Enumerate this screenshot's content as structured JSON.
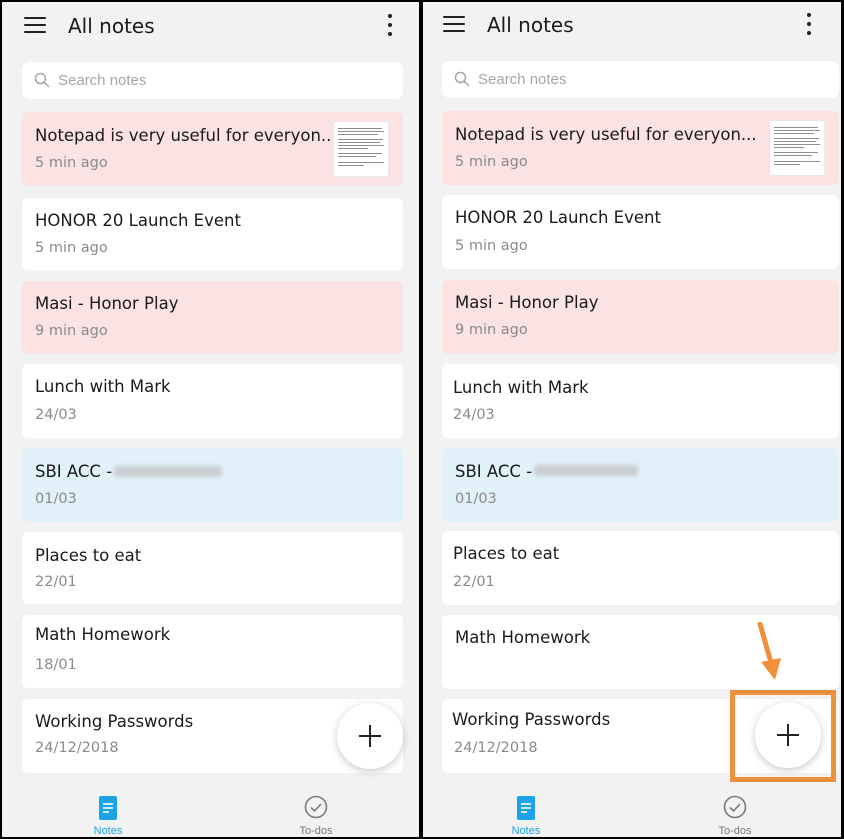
{
  "app": {
    "title": "All notes",
    "search_placeholder": "Search notes",
    "notes": [
      {
        "title": "Notepad is very useful for everyon...",
        "time": "5 min ago",
        "color": "#fbe2e3",
        "has_thumbnail": true
      },
      {
        "title": "HONOR 20 Launch Event",
        "time": "5 min ago",
        "color": "#ffffff"
      },
      {
        "title": "Masi - Honor Play",
        "time": "9 min ago",
        "color": "#fbe2e3"
      },
      {
        "title": "Lunch with Mark",
        "time": "24/03",
        "color": "#ffffff"
      },
      {
        "title": "SBI ACC -",
        "time": "01/03",
        "color": "#e1f1fa",
        "redacted": true
      },
      {
        "title": "Places to eat",
        "time": "22/01",
        "color": "#ffffff"
      },
      {
        "title": "Math Homework",
        "time": "18/01",
        "color": "#ffffff"
      },
      {
        "title": "Working Passwords",
        "time": "24/12/2018",
        "color": "#ffffff"
      }
    ],
    "bottom_nav": [
      {
        "label": "Notes",
        "icon": "notes-icon",
        "active": true
      },
      {
        "label": "To-dos",
        "icon": "check-circle-icon",
        "active": false
      }
    ],
    "fab_icon": "plus-icon"
  },
  "annotation": {
    "highlight_color": "#f0903a",
    "arrow_icon": "arrow-down-icon",
    "target": "add-note-button"
  },
  "colors": {
    "background": "#f2f2f2",
    "accent": "#1aa3e8",
    "note_pink": "#fbe2e3",
    "note_blue": "#e1f1fa"
  }
}
